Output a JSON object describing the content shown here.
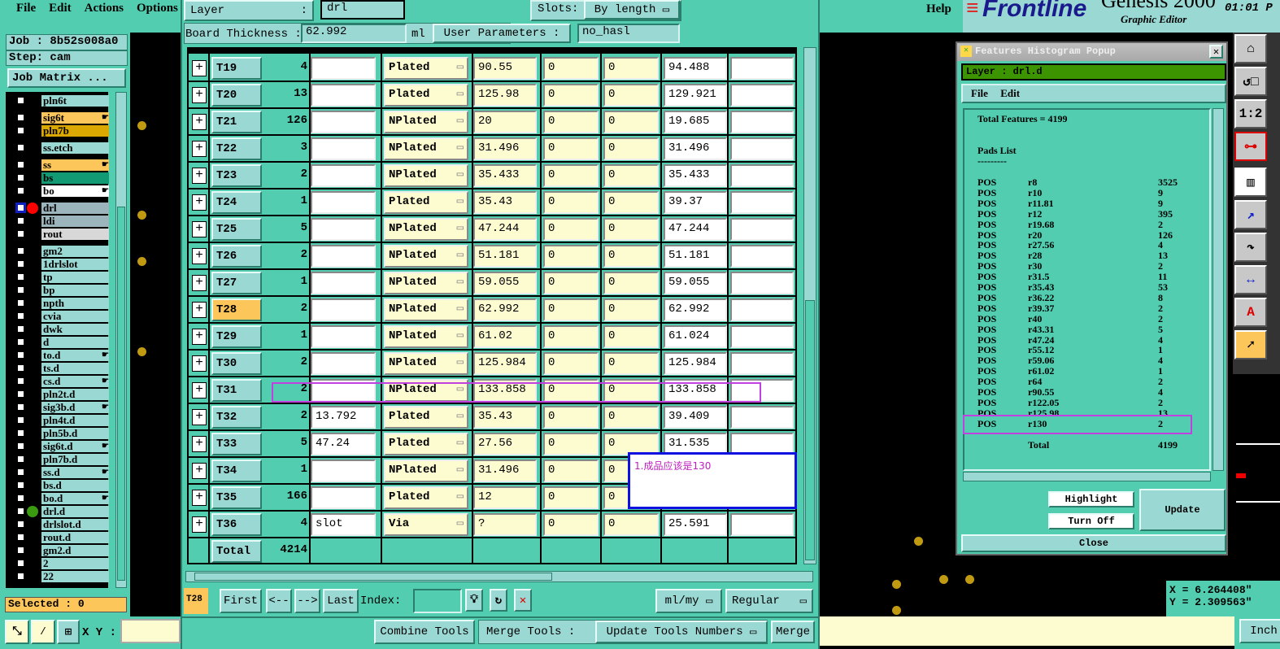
{
  "menu": {
    "file": "File",
    "edit": "Edit",
    "actions": "Actions",
    "options": "Options",
    "help": "Help"
  },
  "job": {
    "job": "Job : 8b52s008a0",
    "step": "Step: cam",
    "matrix_button": "Job Matrix ..."
  },
  "layers": [
    {
      "name": "pln6t",
      "color": "#9ad8d4",
      "group": 0
    },
    {
      "name": "sig6t",
      "color": "#fcc65a",
      "group": 1,
      "hand": true
    },
    {
      "name": "pln7b",
      "color": "#daa800",
      "group": 1
    },
    {
      "name": "ss.etch",
      "color": "#9ad8d4",
      "group": 2
    },
    {
      "name": "ss",
      "color": "#fcc65a",
      "group": 3,
      "hand": true
    },
    {
      "name": "bs",
      "color": "#129a74",
      "group": 3
    },
    {
      "name": "bo",
      "color": "#ffffff",
      "group": 3,
      "hand": true
    },
    {
      "name": "drl",
      "color": "#9cb4bc",
      "group": 4,
      "active": true
    },
    {
      "name": "ldi",
      "color": "#9cb4bc",
      "group": 4
    },
    {
      "name": "rout",
      "color": "#d8d8d8",
      "group": 4
    },
    {
      "name": "gm2",
      "color": "#9ad8d4",
      "group": 5
    },
    {
      "name": "1drlslot",
      "color": "#9ad8d4",
      "group": 5
    },
    {
      "name": "tp",
      "color": "#9ad8d4",
      "group": 5
    },
    {
      "name": "bp",
      "color": "#9ad8d4",
      "group": 5
    },
    {
      "name": "npth",
      "color": "#9ad8d4",
      "group": 5
    },
    {
      "name": "cvia",
      "color": "#9ad8d4",
      "group": 5
    },
    {
      "name": "dwk",
      "color": "#9ad8d4",
      "group": 5
    },
    {
      "name": "d",
      "color": "#9ad8d4",
      "group": 5
    },
    {
      "name": "to.d",
      "color": "#9ad8d4",
      "group": 5,
      "hand": true
    },
    {
      "name": "ts.d",
      "color": "#9ad8d4",
      "group": 5
    },
    {
      "name": "cs.d",
      "color": "#9ad8d4",
      "group": 5,
      "hand": true
    },
    {
      "name": "pln2t.d",
      "color": "#9ad8d4",
      "group": 5
    },
    {
      "name": "sig3b.d",
      "color": "#9ad8d4",
      "group": 5,
      "hand": true
    },
    {
      "name": "pln4t.d",
      "color": "#9ad8d4",
      "group": 5
    },
    {
      "name": "pln5b.d",
      "color": "#9ad8d4",
      "group": 5
    },
    {
      "name": "sig6t.d",
      "color": "#9ad8d4",
      "group": 5,
      "hand": true
    },
    {
      "name": "pln7b.d",
      "color": "#9ad8d4",
      "group": 5
    },
    {
      "name": "ss.d",
      "color": "#9ad8d4",
      "group": 5,
      "hand": true
    },
    {
      "name": "bs.d",
      "color": "#9ad8d4",
      "group": 5
    },
    {
      "name": "bo.d",
      "color": "#9ad8d4",
      "group": 5,
      "hand": true
    },
    {
      "name": "drl.d",
      "color": "#9ad8d4",
      "group": 5,
      "work": true
    },
    {
      "name": "drlslot.d",
      "color": "#9ad8d4",
      "group": 5
    },
    {
      "name": "rout.d",
      "color": "#9ad8d4",
      "group": 5
    },
    {
      "name": "gm2.d",
      "color": "#9ad8d4",
      "group": 5
    },
    {
      "name": "2",
      "color": "#9ad8d4",
      "group": 5
    },
    {
      "name": "22",
      "color": "#9ad8d4",
      "group": 5
    }
  ],
  "selected": "Selected : 0",
  "xy_label": "X Y :",
  "xy_value": "",
  "drill": {
    "layer_label": "Layer",
    "layer_colon": ":",
    "layer_value": "drl",
    "slots_label": "Slots:",
    "slots_value": "By length",
    "thickness_label": "Board Thickness :",
    "thickness_value": "62.992",
    "thickness_unit": "ml",
    "user_params_label": "User Parameters :",
    "user_params_value": "no_hasl",
    "rows": [
      {
        "tool": "T19",
        "count": "4",
        "c1": "",
        "type": "Plated",
        "c3": "90.55",
        "c4": "0",
        "c5": "0",
        "c6": "94.488",
        "c7": ""
      },
      {
        "tool": "T20",
        "count": "13",
        "c1": "",
        "type": "Plated",
        "c3": "125.98",
        "c4": "0",
        "c5": "0",
        "c6": "129.921",
        "c7": ""
      },
      {
        "tool": "T21",
        "count": "126",
        "c1": "",
        "type": "NPlated",
        "c3": "20",
        "c4": "0",
        "c5": "0",
        "c6": "19.685",
        "c7": ""
      },
      {
        "tool": "T22",
        "count": "3",
        "c1": "",
        "type": "NPlated",
        "c3": "31.496",
        "c4": "0",
        "c5": "0",
        "c6": "31.496",
        "c7": ""
      },
      {
        "tool": "T23",
        "count": "2",
        "c1": "",
        "type": "NPlated",
        "c3": "35.433",
        "c4": "0",
        "c5": "0",
        "c6": "35.433",
        "c7": ""
      },
      {
        "tool": "T24",
        "count": "1",
        "c1": "",
        "type": "Plated",
        "c3": "35.43",
        "c4": "0",
        "c5": "0",
        "c6": "39.37",
        "c7": ""
      },
      {
        "tool": "T25",
        "count": "5",
        "c1": "",
        "type": "NPlated",
        "c3": "47.244",
        "c4": "0",
        "c5": "0",
        "c6": "47.244",
        "c7": ""
      },
      {
        "tool": "T26",
        "count": "2",
        "c1": "",
        "type": "NPlated",
        "c3": "51.181",
        "c4": "0",
        "c5": "0",
        "c6": "51.181",
        "c7": ""
      },
      {
        "tool": "T27",
        "count": "1",
        "c1": "",
        "type": "NPlated",
        "c3": "59.055",
        "c4": "0",
        "c5": "0",
        "c6": "59.055",
        "c7": ""
      },
      {
        "tool": "T28",
        "count": "2",
        "c1": "",
        "type": "NPlated",
        "c3": "62.992",
        "c4": "0",
        "c5": "0",
        "c6": "62.992",
        "c7": "",
        "current": true
      },
      {
        "tool": "T29",
        "count": "1",
        "c1": "",
        "type": "NPlated",
        "c3": "61.02",
        "c4": "0",
        "c5": "0",
        "c6": "61.024",
        "c7": ""
      },
      {
        "tool": "T30",
        "count": "2",
        "c1": "",
        "type": "NPlated",
        "c3": "125.984",
        "c4": "0",
        "c5": "0",
        "c6": "125.984",
        "c7": ""
      },
      {
        "tool": "T31",
        "count": "2",
        "c1": "",
        "type": "NPlated",
        "c3": "133.858",
        "c4": "0",
        "c5": "0",
        "c6": "133.858",
        "c7": ""
      },
      {
        "tool": "T32",
        "count": "2",
        "c1": "13.792",
        "type": "Plated",
        "c3": "35.43",
        "c4": "0",
        "c5": "0",
        "c6": "39.409",
        "c7": ""
      },
      {
        "tool": "T33",
        "count": "5",
        "c1": "47.24",
        "type": "Plated",
        "c3": "27.56",
        "c4": "0",
        "c5": "0",
        "c6": "31.535",
        "c7": ""
      },
      {
        "tool": "T34",
        "count": "1",
        "c1": "",
        "type": "NPlated",
        "c3": "31.496",
        "c4": "0",
        "c5": "0",
        "c6": "",
        "c7": ""
      },
      {
        "tool": "T35",
        "count": "166",
        "c1": "",
        "type": "Plated",
        "c3": "12",
        "c4": "0",
        "c5": "0",
        "c6": "",
        "c7": ""
      },
      {
        "tool": "T36",
        "count": "4",
        "c1": "slot",
        "type": "Via",
        "c3": "?",
        "c4": "0",
        "c5": "0",
        "c6": "25.591",
        "c7": ""
      }
    ],
    "total_label": "Total",
    "total_value": "4214",
    "current_tool": "T28",
    "nav": {
      "first": "First",
      "prev": "<--",
      "next": "-->",
      "last": "Last",
      "index_label": "Index:",
      "index_value": "",
      "units": "ml/my",
      "mode": "Regular"
    },
    "combine": "Combine Tools",
    "merge_label": "Merge Tools :",
    "merge_option": "Update Tools Numbers",
    "merge": "Merge"
  },
  "annotation": "1.成品应该是130",
  "logo": {
    "brand": "Frontline",
    "product": "Genesis 2000",
    "subtitle": "Graphic Editor",
    "clock": "01:01 P"
  },
  "histogram": {
    "title": "Features Histogram Popup",
    "layer": "Layer :  drl.d",
    "menu_file": "File",
    "menu_edit": "Edit",
    "total_features": "Total Features = 4199",
    "pads_title": "Pads List",
    "pads_rule": "---------",
    "pads": [
      [
        "POS",
        "r8",
        "3525"
      ],
      [
        "POS",
        "r10",
        "9"
      ],
      [
        "POS",
        "r11.81",
        "9"
      ],
      [
        "POS",
        "r12",
        "395"
      ],
      [
        "POS",
        "r19.68",
        "2"
      ],
      [
        "POS",
        "r20",
        "126"
      ],
      [
        "POS",
        "r27.56",
        "4"
      ],
      [
        "POS",
        "r28",
        "13"
      ],
      [
        "POS",
        "r30",
        "2"
      ],
      [
        "POS",
        "r31.5",
        "11"
      ],
      [
        "POS",
        "r35.43",
        "53"
      ],
      [
        "POS",
        "r36.22",
        "8"
      ],
      [
        "POS",
        "r39.37",
        "2"
      ],
      [
        "POS",
        "r40",
        "2"
      ],
      [
        "POS",
        "r43.31",
        "5"
      ],
      [
        "POS",
        "r47.24",
        "4"
      ],
      [
        "POS",
        "r55.12",
        "1"
      ],
      [
        "POS",
        "r59.06",
        "4"
      ],
      [
        "POS",
        "r61.02",
        "1"
      ],
      [
        "POS",
        "r64",
        "2"
      ],
      [
        "POS",
        "r90.55",
        "4"
      ],
      [
        "POS",
        "r122.05",
        "2"
      ],
      [
        "POS",
        "r125.98",
        "13"
      ],
      [
        "POS",
        "r130",
        "2"
      ]
    ],
    "total_label": "Total",
    "total_value": "4199",
    "highlight": "Highlight",
    "turn_off": "Turn Off",
    "update": "Update",
    "close": "Close"
  },
  "coords": {
    "x": "X = 6.264408\"",
    "y": "Y = 2.309563\""
  },
  "units_button": "Inch"
}
